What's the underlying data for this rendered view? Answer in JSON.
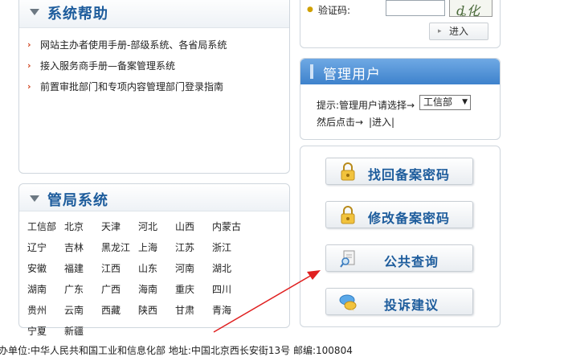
{
  "help": {
    "title": "系统帮助",
    "links": [
      "网站主办者使用手册-部级系统、各省局系统",
      "接入服务商手册—备案管理系统",
      "前置审批部门和专项内容管理部门登录指南"
    ]
  },
  "bureau": {
    "title": "管局系统",
    "regions": [
      "工信部",
      "北京",
      "天津",
      "河北",
      "山西",
      "内蒙古",
      "辽宁",
      "吉林",
      "黑龙江",
      "上海",
      "江苏",
      "浙江",
      "安徽",
      "福建",
      "江西",
      "山东",
      "河南",
      "湖北",
      "湖南",
      "广东",
      "广西",
      "海南",
      "重庆",
      "四川",
      "贵州",
      "云南",
      "西藏",
      "陕西",
      "甘肃",
      "青海",
      "宁夏",
      "新疆"
    ]
  },
  "login": {
    "captcha_label": "验证码:",
    "captcha_value": "",
    "captcha_image_text": "ȡ化ƚ5",
    "enter_button": "进入"
  },
  "admin": {
    "title": "管理用户",
    "hint": "提示:管理用户请选择→",
    "select_value": "工信部",
    "then_text": "然后点击→",
    "enter_link": "|进入|"
  },
  "actions": {
    "retrieve_password": "找回备案密码",
    "modify_password": "修改备案密码",
    "public_query": "公共查询",
    "complaint": "投诉建议"
  },
  "footer": {
    "text": "办单位:中华人民共和国工业和信息化部 地址:中国北京西长安街13号 邮编:100804"
  },
  "colors": {
    "title_blue": "#1d5c9c",
    "bullet_red": "#d0411b",
    "admin_header": "#4a8ad2",
    "annotation_arrow": "#e02020"
  }
}
